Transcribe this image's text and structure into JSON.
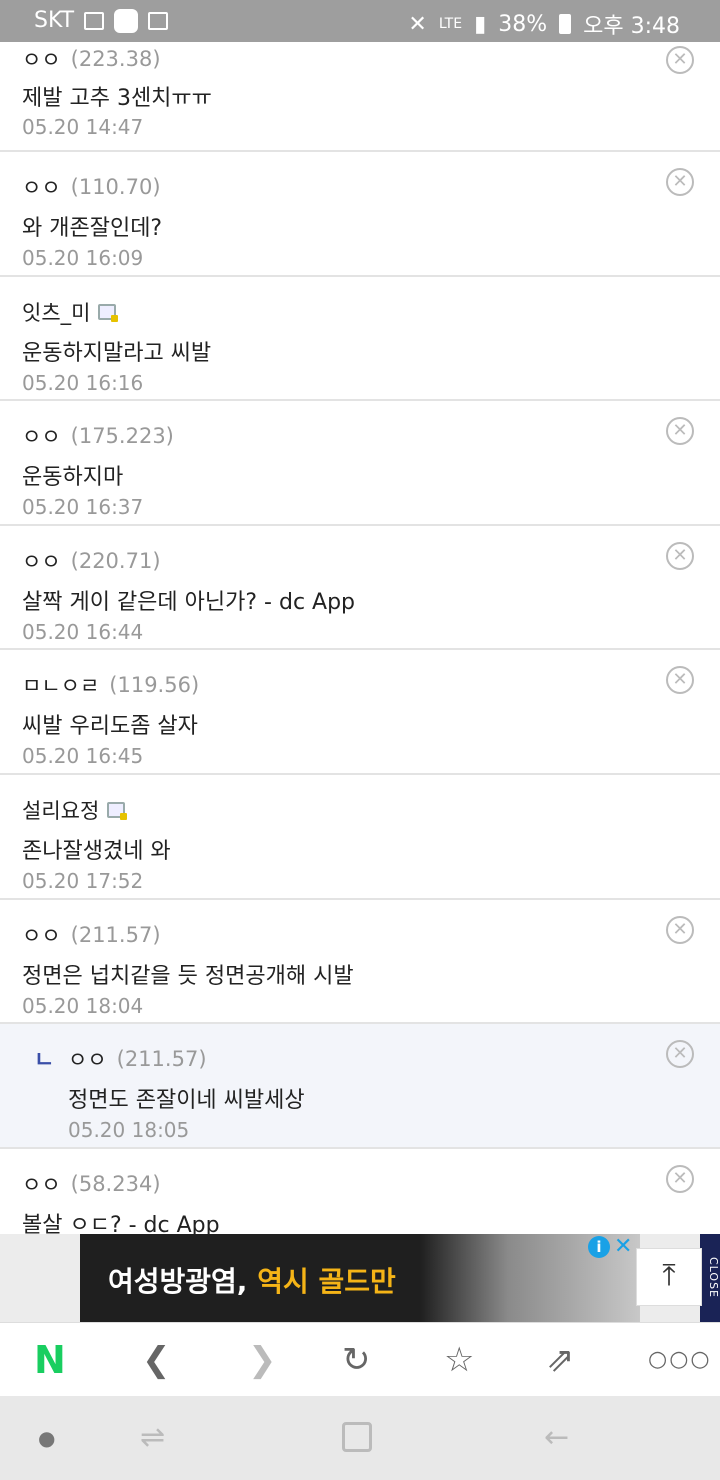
{
  "status_bar": {
    "carrier": "SKT",
    "network": "LTE",
    "battery": "38%",
    "time": "오후 3:48"
  },
  "comments": [
    {
      "author": "ㅇㅇ",
      "ip": "(223.38)",
      "body": "제발 고추 3센치ㅠㅠ",
      "date": "05.20 14:47"
    },
    {
      "author": "ㅇㅇ",
      "ip": "(110.70)",
      "body": "와 개존잘인데?",
      "date": "05.20 16:09"
    },
    {
      "author": "잇츠_미",
      "ip": "",
      "body": "운동하지말라고 씨발",
      "date": "05.20 16:16"
    },
    {
      "author": "ㅇㅇ",
      "ip": "(175.223)",
      "body": "운동하지마",
      "date": "05.20 16:37"
    },
    {
      "author": "ㅇㅇ",
      "ip": "(220.71)",
      "body": "살짝 게이 같은데 아닌가? - dc App",
      "date": "05.20 16:44"
    },
    {
      "author": "ㅁㄴㅇㄹ",
      "ip": "(119.56)",
      "body": "씨발 우리도좀 살자",
      "date": "05.20 16:45"
    },
    {
      "author": "설리요정",
      "ip": "",
      "body": "존나잘생겼네 와",
      "date": "05.20 17:52"
    },
    {
      "author": "ㅇㅇ",
      "ip": "(211.57)",
      "body": "정면은 넙치같을 듯 정면공개해 시발",
      "date": "05.20 18:04"
    },
    {
      "author": "ㅇㅇ",
      "ip": "(211.57)",
      "body": "정면도 존잘이네 씨발세상",
      "date": "05.20 18:05"
    },
    {
      "author": "ㅇㅇ",
      "ip": "(58.234)",
      "body": "볼살 ㅇㄷ? - dc App",
      "date": ""
    }
  ],
  "reply_marker": "ㄴ",
  "ad": {
    "text_main": "여성방광염,",
    "text_highlight": "역시 골드만",
    "close_label": "CLOSE"
  },
  "toolbar": {
    "naver_label": "N"
  },
  "icons": {
    "delete": "circle-x-icon",
    "gallog": "gallog-icon",
    "back": "chevron-left-icon",
    "forward": "chevron-right-icon",
    "reload": "reload-icon",
    "bookmark": "star-icon",
    "share": "share-icon",
    "more": "more-dots-icon",
    "scroll_top": "arrow-up-icon"
  },
  "colors": {
    "status_bar": "#9e9e9e",
    "naver_green": "#19ce60",
    "reply_bg": "#f3f5fa",
    "reply_marker": "#3a4fa8",
    "ad_highlight": "#f5b417"
  }
}
